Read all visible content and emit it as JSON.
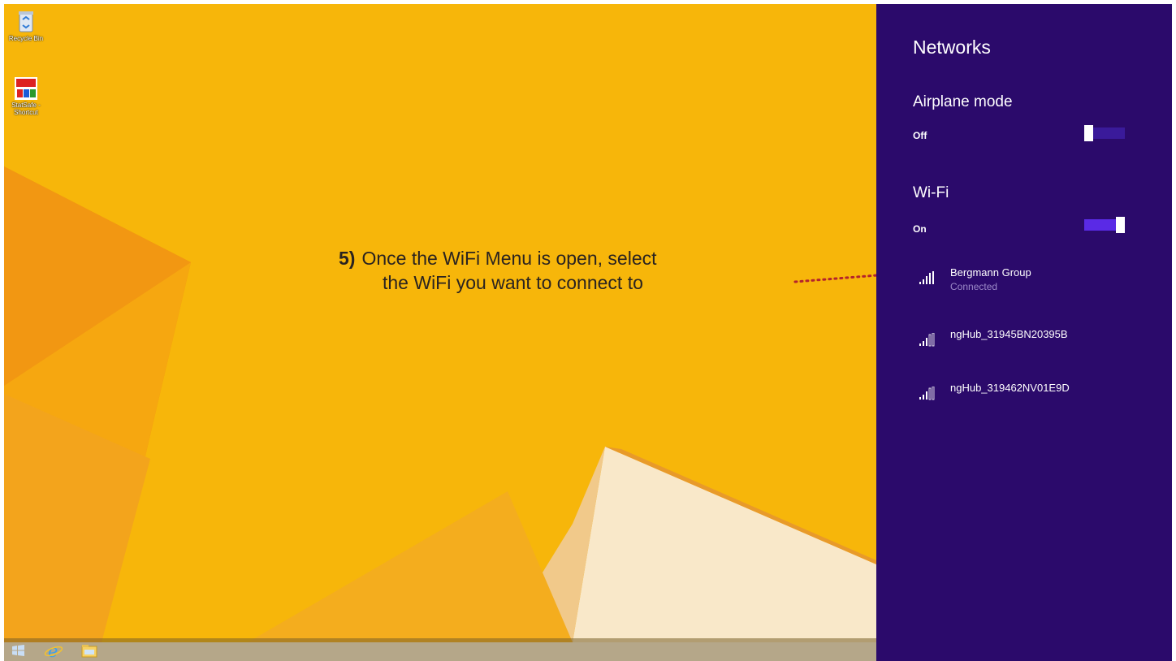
{
  "desktop": {
    "icons": [
      {
        "label": "Recycle Bin",
        "icon": "recycle-bin-icon"
      },
      {
        "label": "StatSafe - Shortcut",
        "icon": "statsafe-shortcut-icon"
      }
    ]
  },
  "taskbar": {
    "items": [
      {
        "icon": "windows-start-icon"
      },
      {
        "icon": "internet-explorer-icon"
      },
      {
        "icon": "file-explorer-icon"
      }
    ]
  },
  "annotation": {
    "number": "5)",
    "line1": "Once the WiFi Menu is open, select",
    "line2": "the WiFi you want to connect to"
  },
  "networks_panel": {
    "title": "Networks",
    "airplane_mode": {
      "label": "Airplane mode",
      "state": "Off"
    },
    "wifi": {
      "label": "Wi-Fi",
      "state": "On"
    },
    "networks": [
      {
        "name": "Bergmann Group",
        "status": "Connected"
      },
      {
        "name": "ngHub_31945BN20395B",
        "status": ""
      },
      {
        "name": "ngHub_319462NV01E9D",
        "status": ""
      }
    ]
  },
  "colors": {
    "panel_bg": "#2b0a6b",
    "wallpaper_yellow": "#f7b60a",
    "toggle_on": "#5a2ae6",
    "arrow_red": "#b4232c"
  }
}
